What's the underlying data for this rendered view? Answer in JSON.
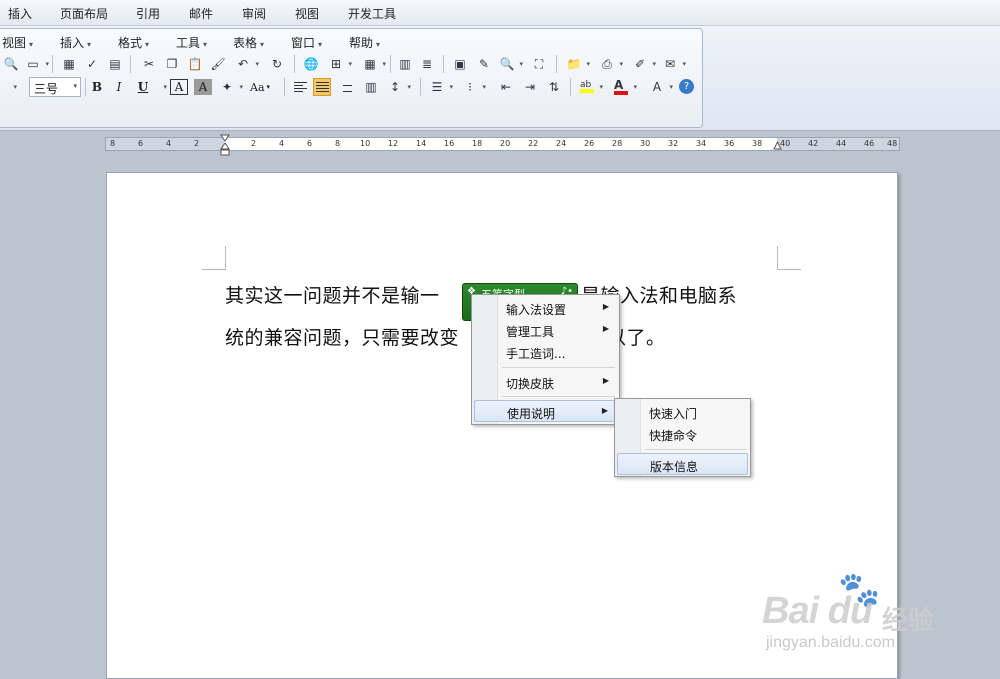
{
  "tabs": [
    {
      "label": "插入"
    },
    {
      "label": "页面布局"
    },
    {
      "label": "引用"
    },
    {
      "label": "邮件"
    },
    {
      "label": "审阅"
    },
    {
      "label": "视图"
    },
    {
      "label": "开发工具"
    }
  ],
  "menubar": {
    "items": [
      {
        "label": "视图"
      },
      {
        "label": "插入"
      },
      {
        "label": "格式"
      },
      {
        "label": "工具"
      },
      {
        "label": "表格"
      },
      {
        "label": "窗口"
      },
      {
        "label": "帮助"
      }
    ]
  },
  "format_toolbar": {
    "font_size": "三号",
    "bold": "B",
    "italic": "I",
    "underline": "U",
    "char_border": "A",
    "char_shading": "A",
    "change_case": "Aa",
    "colors": {
      "highlight": "#ffff00",
      "font_color": "#e01010"
    }
  },
  "ruler": {
    "ticks": [
      "8",
      "6",
      "4",
      "2",
      "2",
      "4",
      "6",
      "8",
      "10",
      "12",
      "14",
      "16",
      "18",
      "20",
      "22",
      "24",
      "26",
      "28",
      "30",
      "32",
      "34",
      "36",
      "38",
      "40",
      "42",
      "44",
      "46",
      "48"
    ]
  },
  "document": {
    "line1_a": "其实这一问题并不是输一",
    "line1_b": "只是输入法和电脑系",
    "line2_a": "统的兼容问题，只需要改变",
    "line2_b": "以了。"
  },
  "ime_bar": {
    "label": "五笔字型",
    "color": "#237a23"
  },
  "context_menu": {
    "items": [
      {
        "label": "输入法设置",
        "has_submenu": true
      },
      {
        "label": "管理工具",
        "has_submenu": true
      },
      {
        "label": "手工造词...",
        "has_submenu": false
      },
      {
        "label": "切换皮肤",
        "has_submenu": true
      },
      {
        "label": "使用说明",
        "has_submenu": true
      }
    ]
  },
  "submenu": {
    "items": [
      {
        "label": "快速入门"
      },
      {
        "label": "快捷命令"
      },
      {
        "label": "版本信息"
      }
    ]
  },
  "watermark": {
    "brand": "Bai du",
    "product": "经验",
    "url": "jingyan.baidu.com"
  }
}
